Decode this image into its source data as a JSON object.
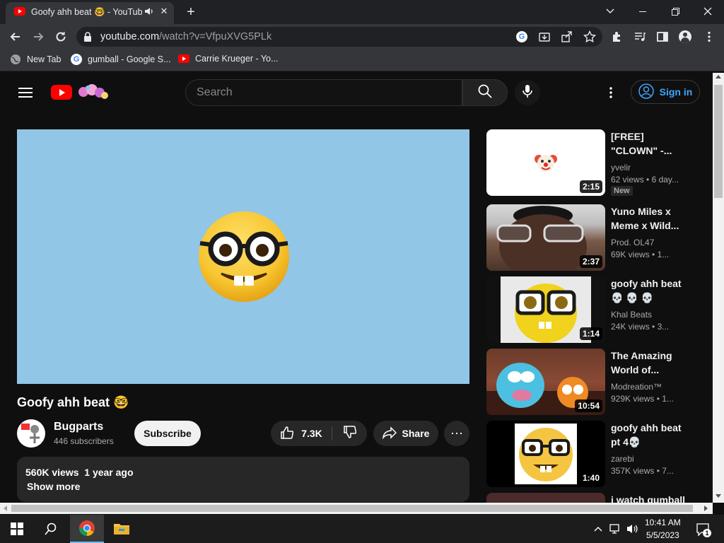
{
  "browser": {
    "tab_title": "Goofy ahh beat 🤓 - YouTub",
    "new_tab_symbol": "+",
    "url_host": "youtube.com",
    "url_path": "/watch?v=VfpuXVG5PLk",
    "bookmarks": [
      {
        "label": "New Tab",
        "icon": "globe-icon"
      },
      {
        "label": "gumball - Google S...",
        "icon": "google-icon"
      },
      {
        "label": "Carrie Krueger - Yo...",
        "icon": "youtube-icon"
      }
    ]
  },
  "youtube": {
    "search_placeholder": "Search",
    "signin_label": "Sign in",
    "video_title": "Goofy ahh beat 🤓",
    "channel_name": "Bugparts",
    "subscribers": "446 subscribers",
    "subscribe_label": "Subscribe",
    "likes": "7.3K",
    "share_label": "Share",
    "more_symbol": "⋯",
    "description_meta": "560K views  1 year ago",
    "show_more": "Show more"
  },
  "related": [
    {
      "title": "[FREE] \"CLOWN\" -...",
      "channel": "yvelir",
      "views": "62 views",
      "age": "6 day...",
      "duration": "2:15",
      "badge": "New"
    },
    {
      "title": "Yuno Miles x Meme x Wild...",
      "channel": "Prod. OL47",
      "views": "69K views",
      "age": "1...",
      "duration": "2:37"
    },
    {
      "title": "goofy ahh beat 💀 💀 💀",
      "channel": "Khal Beats",
      "views": "24K views",
      "age": "3...",
      "duration": "1:14"
    },
    {
      "title": "The Amazing World of...",
      "channel": "Modreation™",
      "views": "929K views",
      "age": "1...",
      "duration": "10:54"
    },
    {
      "title": "goofy ahh beat pt 4💀",
      "channel": "zarebi",
      "views": "357K views",
      "age": "7...",
      "duration": "1:40"
    },
    {
      "title": "i watch gumball",
      "channel": "",
      "views": "",
      "age": "",
      "duration": ""
    }
  ],
  "taskbar": {
    "time": "10:41 AM",
    "date": "5/5/2023",
    "notification_count": "1"
  }
}
